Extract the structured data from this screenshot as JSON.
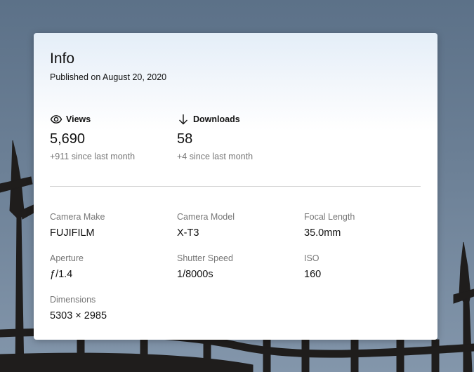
{
  "info": {
    "title": "Info",
    "published": "Published on August 20, 2020"
  },
  "stats": {
    "views": {
      "icon": "eye-icon",
      "label": "Views",
      "value": "5,690",
      "delta": "+911 since last month"
    },
    "downloads": {
      "icon": "arrow-down-icon",
      "label": "Downloads",
      "value": "58",
      "delta": "+4 since last month"
    }
  },
  "exif": {
    "camera_make": {
      "label": "Camera Make",
      "value": "FUJIFILM"
    },
    "camera_model": {
      "label": "Camera Model",
      "value": "X-T3"
    },
    "focal_length": {
      "label": "Focal Length",
      "value": "35.0mm"
    },
    "aperture": {
      "label": "Aperture",
      "value": "ƒ/1.4"
    },
    "shutter_speed": {
      "label": "Shutter Speed",
      "value": "1/8000s"
    },
    "iso": {
      "label": "ISO",
      "value": "160"
    },
    "dimensions": {
      "label": "Dimensions",
      "value": "5303 × 2985"
    }
  },
  "colors": {
    "sky": "#6c8096",
    "text": "#111111",
    "muted": "#767676",
    "divider": "#d1d1d1"
  }
}
